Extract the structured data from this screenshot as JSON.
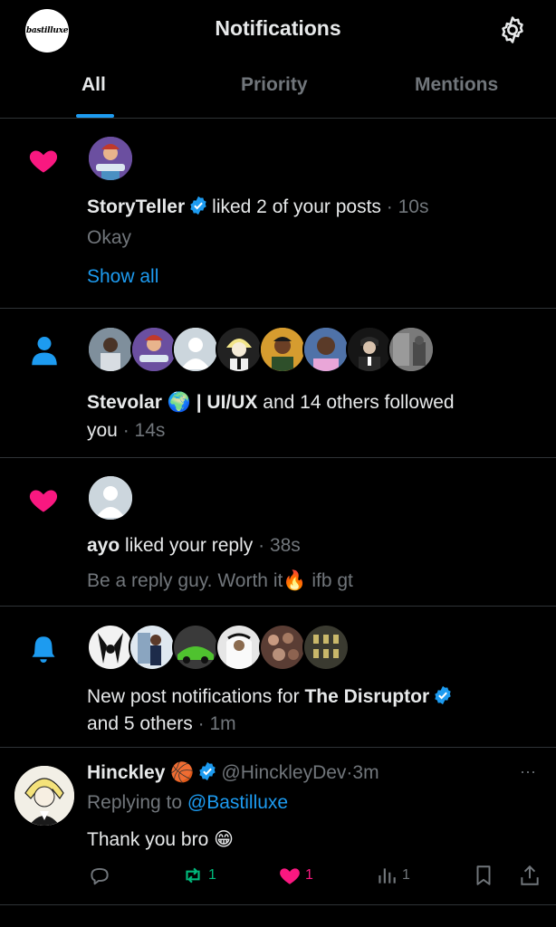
{
  "header": {
    "logo_text": "bastilluxe",
    "title": "Notifications"
  },
  "tabs": [
    {
      "label": "All",
      "active": true
    },
    {
      "label": "Priority",
      "active": false
    },
    {
      "label": "Mentions",
      "active": false
    }
  ],
  "notifications": [
    {
      "kind": "like",
      "actor": "StoryTeller",
      "action": "liked 2 of your posts",
      "separator": "·",
      "time": "10s",
      "snippet": "Okay",
      "show_all": "Show all"
    },
    {
      "kind": "follow",
      "actor": "Stevolar",
      "actor_suffix": "| UI/UX",
      "action": "and 14 others followed",
      "action_line2": "you",
      "separator": "·",
      "time": "14s"
    },
    {
      "kind": "like",
      "actor": "ayo",
      "action": "liked your reply",
      "separator": "·",
      "time": "38s",
      "snippet": "Be a reply guy. Worth it",
      "snippet_suffix": "ifb gt"
    },
    {
      "kind": "post_notification",
      "action_prefix": "New post notifications for",
      "actor": "The Disruptor",
      "action_line2": "and 5 others",
      "separator": "·",
      "time": "1m"
    }
  ],
  "reply_post": {
    "author": "Hinckley",
    "handle": "@HinckleyDev",
    "separator": "·",
    "time": "3m",
    "replying_to_prefix": "Replying to",
    "replying_to_handle": "@Bastilluxe",
    "text": "Thank you bro",
    "text_emoji": "😁",
    "more": "···",
    "stats": {
      "replies": "",
      "retweets": "1",
      "likes": "1",
      "views": "1"
    }
  },
  "colors": {
    "background": "#000000",
    "text": "#e7e9ea",
    "muted": "#71767b",
    "accent": "#1d9bf0",
    "like": "#f91880",
    "retweet": "#00ba7c",
    "divider": "#2f3336"
  },
  "icons": [
    "bastilluxe-logo",
    "gear-icon",
    "heart-icon",
    "person-icon",
    "bell-icon",
    "verified-icon",
    "globe-emoji",
    "fire-emoji",
    "basketball-emoji",
    "reply-icon",
    "retweet-icon",
    "like-icon",
    "views-icon",
    "bookmark-icon",
    "share-icon"
  ]
}
